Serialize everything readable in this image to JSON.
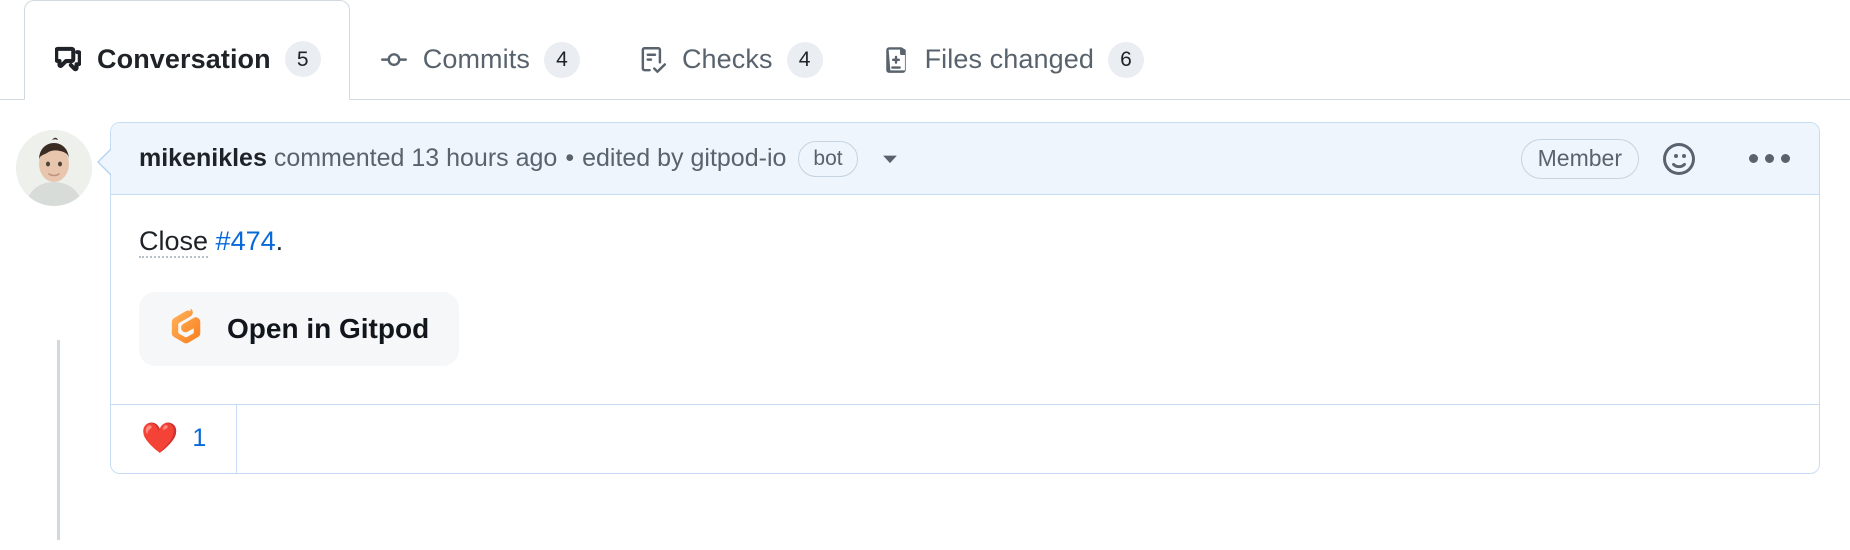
{
  "tabs": [
    {
      "id": "conversation",
      "icon": "comment-discussion-icon",
      "label": "Conversation",
      "count": "5",
      "selected": true
    },
    {
      "id": "commits",
      "icon": "git-commit-icon",
      "label": "Commits",
      "count": "4",
      "selected": false
    },
    {
      "id": "checks",
      "icon": "checklist-icon",
      "label": "Checks",
      "count": "4",
      "selected": false
    },
    {
      "id": "files-changed",
      "icon": "file-diff-icon",
      "label": "Files changed",
      "count": "6",
      "selected": false
    }
  ],
  "comment": {
    "avatar_alt": "mikenikles",
    "author": "mikenikles",
    "action": "commented 13 hours ago",
    "separator": "•",
    "edited_by": "edited by gitpod-io",
    "bot_badge": "bot",
    "caret_icon": "chevron-down-icon",
    "member_badge": "Member",
    "reaction_icon": "smiley-icon",
    "menu_icon": "kebab-horizontal-icon",
    "body": {
      "prefix_abbr": "Close",
      "issue_link": "#474",
      "suffix": ".",
      "gitpod_button": {
        "icon": "gitpod-logo-icon",
        "label": "Open in Gitpod"
      }
    },
    "reactions": [
      {
        "emoji": "❤️",
        "name": "heart-reaction",
        "count": "1"
      }
    ]
  },
  "colors": {
    "accent_link": "#0969da",
    "header_bg": "#eef5fd",
    "header_border": "#c6dcf5",
    "counter_bg": "#eaeef2",
    "muted_text": "#59636e",
    "gitpod_orange": "#f97e1f",
    "tab_border": "#d1d9e0"
  }
}
